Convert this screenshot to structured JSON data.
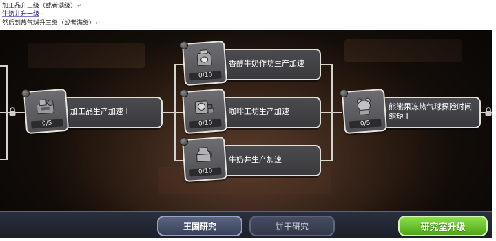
{
  "notes": [
    "加工品升三级（或者满级）",
    "牛奶井升一级",
    "然后到热气球升三级（或者满级）"
  ],
  "paragraph_mark": "↵",
  "tree": {
    "processed_goods": {
      "label": "加工品生产加速 Ⅰ",
      "count": "0/5",
      "icon": "processing-machine-icon"
    },
    "creamery": {
      "label": "香醇牛奶作坊生产加速",
      "count": "0/10",
      "icon": "milk-churn-icon"
    },
    "coffee": {
      "label": "咖啡工坊生产加速",
      "count": "0/10",
      "icon": "coffee-machine-icon"
    },
    "milk_well": {
      "label": "牛奶井生产加速",
      "count": "0/10",
      "icon": "milk-jug-icon"
    },
    "balloon": {
      "label": "熊熊果冻热气球探险时间缩短 Ⅰ",
      "count": "0/5",
      "icon": "bear-jelly-icon"
    }
  },
  "bottom_bar": {
    "kingdom_research": "王国研究",
    "cookie_research": "饼干研究",
    "lab_upgrade": "研究室升级"
  },
  "colors": {
    "node_bg": "#434347",
    "line": "#d6d2cc",
    "upgrade_green": "#6cc832",
    "active_tab": "#4a5470"
  }
}
